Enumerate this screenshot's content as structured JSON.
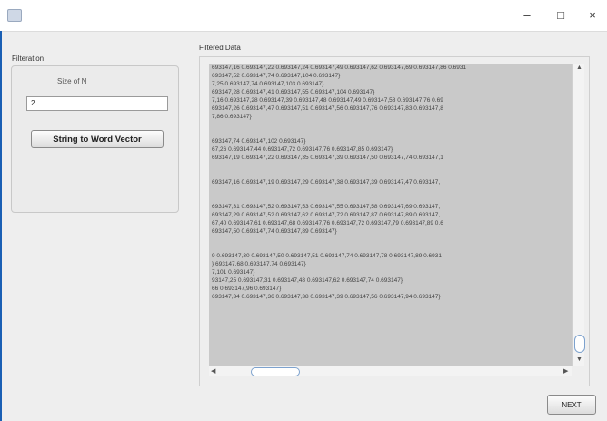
{
  "window": {
    "minimize": "–",
    "maximize": "□",
    "close": "×"
  },
  "filteration": {
    "title": "Filteration",
    "size_label": "Size of N",
    "size_value": "2",
    "button_label": "String to Word Vector"
  },
  "filtered": {
    "title": "Filtered Data",
    "lines": [
      "693147,16 0.693147,22 0.693147,24 0.693147,49 0.693147,62 0.693147,69 0.693147,86 0.6931",
      "693147,52 0.693147,74 0.693147,104 0.693147}",
      "7,25 0.693147,74 0.693147,103 0.693147}",
      "693147,28 0.693147,41 0.693147,55 0.693147,104 0.693147}",
      "7,16 0.693147,28 0.693147,39 0.693147,48 0.693147,49 0.693147,58 0.693147,76 0.69",
      "693147,26 0.693147,47 0.693147,51 0.693147,56 0.693147,76 0.693147,83 0.693147,8",
      "7,86 0.693147}",
      "",
      "",
      "693147,74 0.693147,102 0.693147}",
      "67,26 0.693147,44 0.693147,72 0.693147,76 0.693147,85 0.693147}",
      "693147,19 0.693147,22 0.693147,35 0.693147,39 0.693147,50 0.693147,74 0.693147,1",
      "",
      "",
      "693147,16 0.693147,19 0.693147,29 0.693147,38 0.693147,39 0.693147,47 0.693147,",
      "",
      "",
      "693147,31 0.693147,52 0.693147,53 0.693147,55 0.693147,58 0.693147,69 0.693147,",
      "693147,29 0.693147,52 0.693147,62 0.693147,72 0.693147,87 0.693147,89 0.693147,",
      "67,40 0.693147,61 0.693147,68 0.693147,76 0.693147,72 0.693147,79 0.693147,89 0.6",
      "693147,50 0.693147,74 0.693147,89 0.693147}",
      "",
      "",
      "9 0.693147,30 0.693147,50 0.693147,51 0.693147,74 0.693147,78 0.693147,89 0.6931",
      "} 693147,68 0.693147,74 0.693147}",
      "7,101 0.693147}",
      "93147,25 0.693147,31 0.693147,48 0.693147,62 0.693147,74 0.693147}",
      "66 0.693147,96 0.693147}",
      "693147,34 0.693147,36 0.693147,38 0.693147,39 0.693147,56 0.693147,94 0.693147}"
    ]
  },
  "next_label": "NEXT"
}
